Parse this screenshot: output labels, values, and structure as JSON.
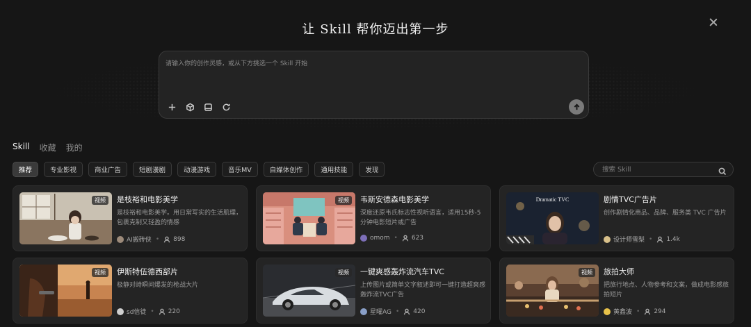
{
  "header": {
    "title": "让 Skill 帮你迈出第一步"
  },
  "prompt": {
    "placeholder": "请输入你的创作灵感，或从下方挑选一个 Skill 开始",
    "tools": [
      "plus-icon",
      "cube-icon",
      "image-frame-icon",
      "refresh-icon"
    ],
    "send_icon": "arrow-up-icon"
  },
  "tabs": [
    {
      "label": "Skill",
      "active": true
    },
    {
      "label": "收藏",
      "active": false
    },
    {
      "label": "我的",
      "active": false
    }
  ],
  "categories": [
    {
      "label": "推荐",
      "active": true
    },
    {
      "label": "专业影视"
    },
    {
      "label": "商业广告"
    },
    {
      "label": "短剧漫剧"
    },
    {
      "label": "动漫游戏"
    },
    {
      "label": "音乐MV"
    },
    {
      "label": "自媒体创作"
    },
    {
      "label": "通用技能"
    },
    {
      "label": "发现"
    }
  ],
  "search": {
    "placeholder": "搜索 Skill"
  },
  "cards": [
    {
      "title": "是枝裕和电影美学",
      "badge": "视频",
      "desc": "是枝裕和电影美学。用日常写实的生活肌理，包裹克制又轻盈的情感",
      "author": "AI搬砖侠",
      "count": "898",
      "avatar_color": "#9c8a7a"
    },
    {
      "title": "韦斯安德森电影美学",
      "badge": "视频",
      "desc": "深度还原韦氏标志性视听语言，适用15秒-5分钟电影短片或广告",
      "author": "omom",
      "count": "623",
      "avatar_color": "#7d6fb8"
    },
    {
      "title": "剧情TVC广告片",
      "badge": "",
      "desc": "创作剧情化商品、品牌、服务类 TVC 广告片",
      "author": "设计师雪梨",
      "count": "1.4k",
      "avatar_color": "#d8c08a",
      "thumb_text": "Dramatic TVC"
    },
    {
      "title": "伊斯特伍德西部片",
      "badge": "视频",
      "desc": "极静对峙瞬间爆发的枪战大片",
      "author": "sd信徒",
      "count": "220",
      "avatar_color": "#cfcfcf"
    },
    {
      "title": "一键爽感轰炸流汽车TVC",
      "badge": "视频",
      "desc": "上传图片或简单文字叙述即可一键打造超爽感轰炸流TVC广告",
      "author": "星曜AG",
      "count": "420",
      "avatar_color": "#8aa0c8"
    },
    {
      "title": "旅拍大师",
      "badge": "视频",
      "desc": "把旅行地点、人物参考和文案，做成电影感旅拍短片",
      "author": "黄鑫波",
      "count": "294",
      "avatar_color": "#e8c24a"
    }
  ]
}
